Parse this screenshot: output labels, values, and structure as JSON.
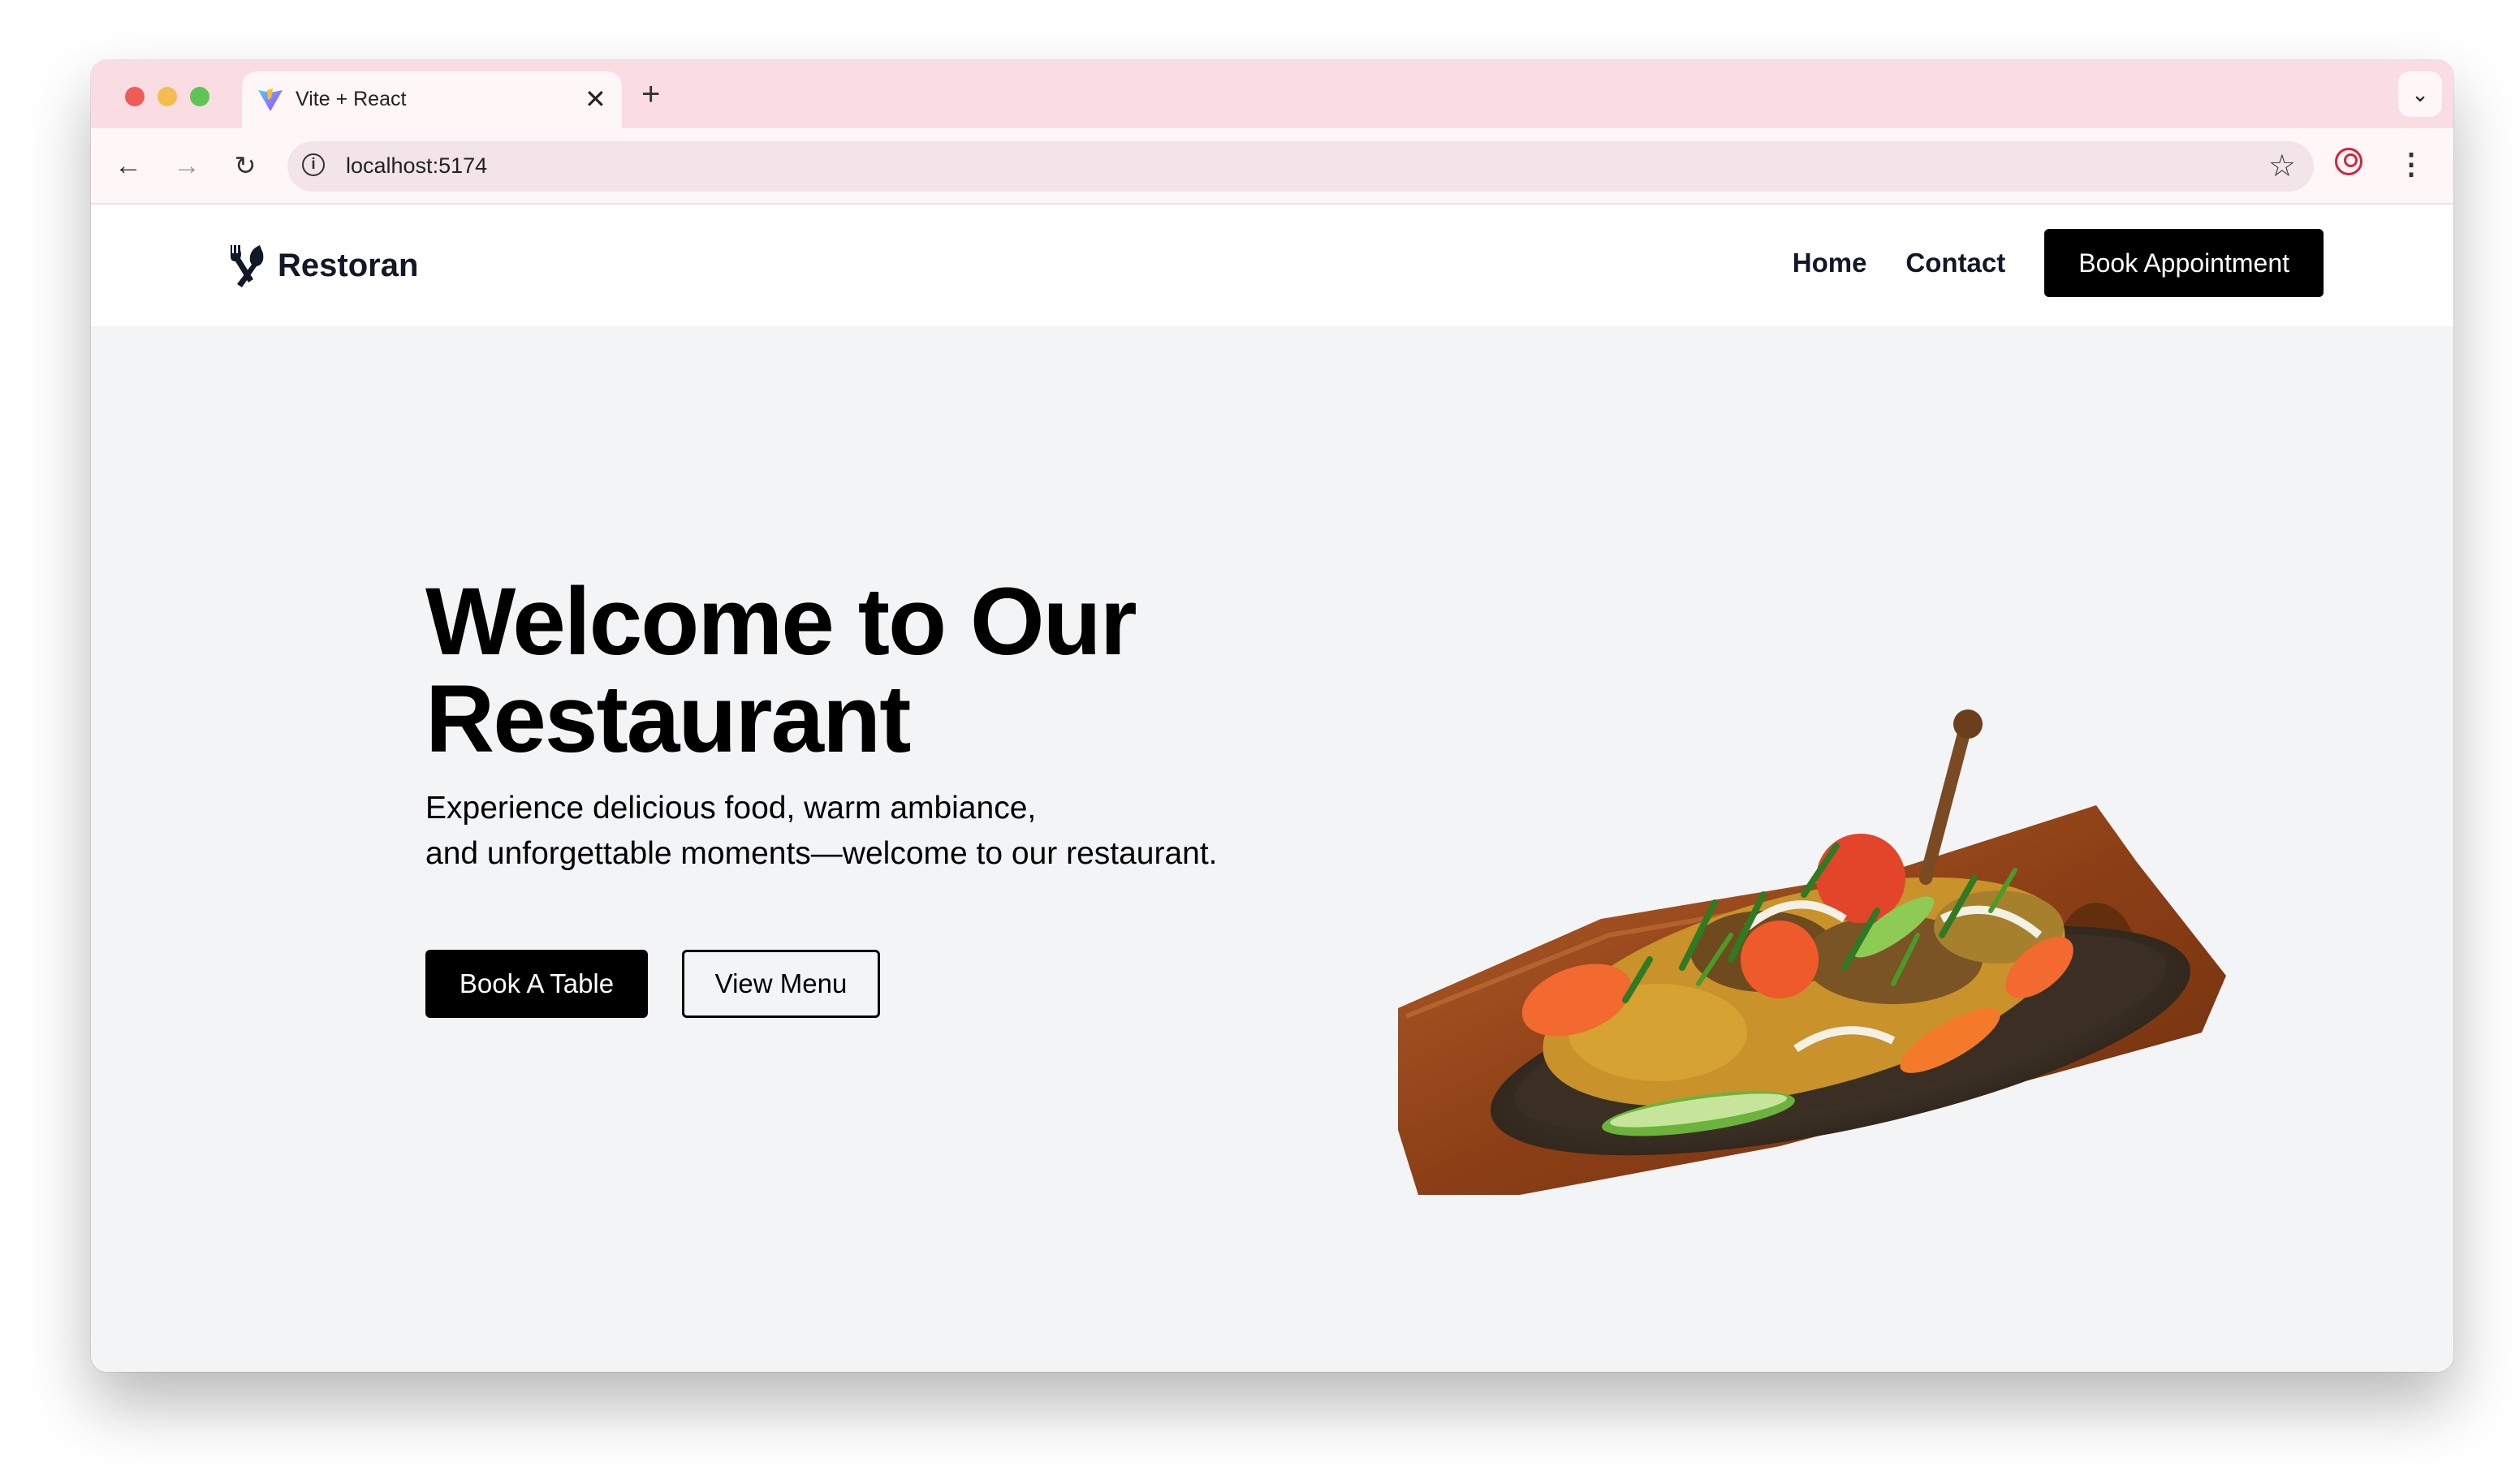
{
  "browser": {
    "tab_title": "Vite + React",
    "tab_close_icon": "close-icon",
    "new_tab_icon": "plus-icon",
    "url": "localhost:5174"
  },
  "site": {
    "logo_text": "Restoran",
    "logo_icon": "utensils-icon",
    "nav": [
      {
        "label": "Home"
      },
      {
        "label": "Contact"
      }
    ],
    "cta_label": "Book Appointment"
  },
  "hero": {
    "title_line1": "Welcome to Our",
    "title_line2": "Restaurant",
    "subtitle_line1": "Experience delicious food, warm ambiance,",
    "subtitle_line2": "and unforgettable moments—welcome to our restaurant.",
    "primary_button": "Book A Table",
    "secondary_button": "View Menu",
    "image": "sizzler-dish-image"
  },
  "colors": {
    "tabstrip": "#f9dde3",
    "page_bg": "#f3f4f6",
    "button_bg": "#000000",
    "profile_accent": "#d4243a"
  }
}
